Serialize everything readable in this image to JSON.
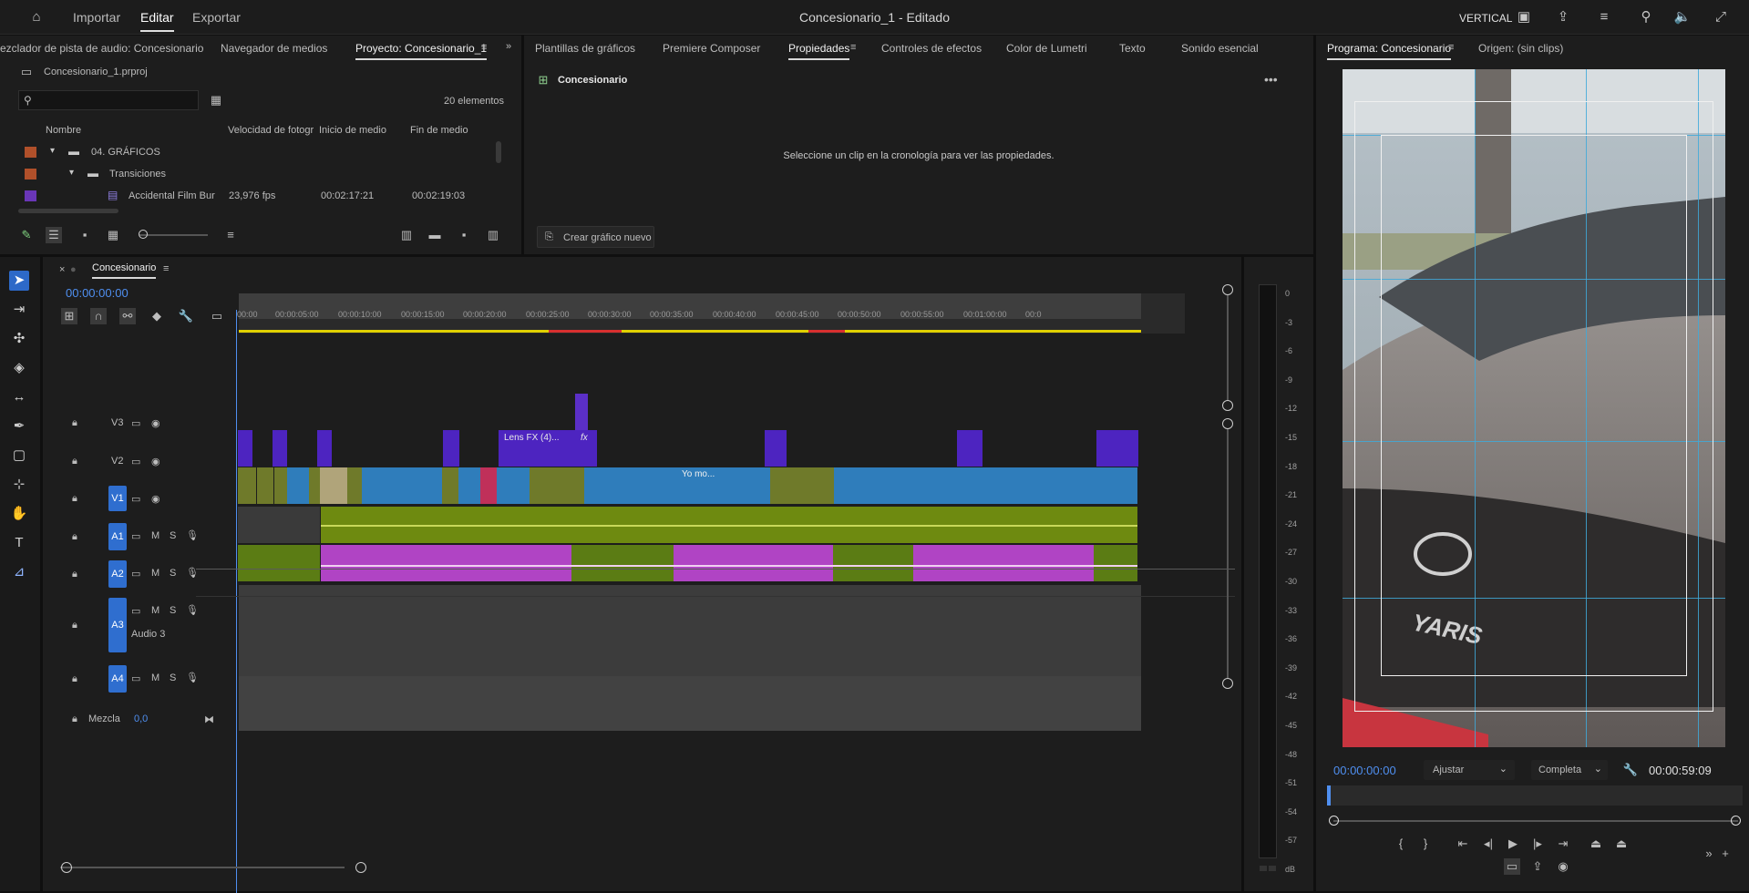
{
  "topbar": {
    "nav": [
      "Importar",
      "Editar",
      "Exportar"
    ],
    "title": "Concesionario_1 - Editado",
    "workspace": "VERTICAL"
  },
  "project_panel": {
    "tabs": [
      "ezclador de pista de audio: Concesionario",
      "Navegador de medios",
      "Proyecto: Concesionario_1"
    ],
    "file": "Concesionario_1.prproj",
    "search_placeholder": "",
    "count": "20 elementos",
    "columns": [
      "Nombre",
      "Velocidad de fotogr",
      "Inicio de medio",
      "Fin de medio"
    ],
    "rows": [
      {
        "name": "04. GRÁFICOS",
        "fps": "",
        "start": "",
        "end": "",
        "color": "#b0502a"
      },
      {
        "name": "Transiciones",
        "fps": "",
        "start": "",
        "end": "",
        "color": "#b0502a"
      },
      {
        "name": "Accidental Film Bur",
        "fps": "23,976 fps",
        "start": "00:02:17:21",
        "end": "00:02:19:03",
        "color": "#6a36b8"
      }
    ]
  },
  "props_panel": {
    "tabs": [
      "Plantillas de gráficos",
      "Premiere Composer",
      "Propiedades",
      "Controles de efectos",
      "Color de Lumetri",
      "Texto",
      "Sonido esencial"
    ],
    "sequence": "Concesionario",
    "message": "Seleccione un clip en la cronología para ver las propiedades.",
    "new_graphic": "Crear gráfico nuevo"
  },
  "program_panel": {
    "tabs": [
      "Programa: Concesionario",
      "Origen: (sin clips)"
    ],
    "timecode_left": "00:00:00:00",
    "fit": "Ajustar",
    "quality": "Completa",
    "timecode_right": "00:00:59:09",
    "car_text": "YARIS"
  },
  "timeline": {
    "sequence_tab": "Concesionario",
    "timecode": "00:00:00:00",
    "ruler": [
      "00:00",
      "00:00:05:00",
      "00:00:10:00",
      "00:00:15:00",
      "00:00:20:00",
      "00:00:25:00",
      "00:00:30:00",
      "00:00:35:00",
      "00:00:40:00",
      "00:00:45:00",
      "00:00:50:00",
      "00:00:55:00",
      "00:01:00:00",
      "00:0"
    ],
    "tracks": {
      "v3": "V3",
      "v2": "V2",
      "v1": "V1",
      "a1": "A1",
      "a2": "A2",
      "a3": "A3",
      "a4": "A4",
      "m": "M",
      "s": "S",
      "audio3_name": "Audio 3",
      "mix": "Mezcla",
      "mix_value": "0,0"
    },
    "clip_labels": [
      "Lens FX (4)...",
      "Yo mo...",
      "fx"
    ]
  },
  "meter": {
    "labels": [
      "0",
      "-3",
      "-6",
      "-9",
      "-12",
      "-15",
      "-18",
      "-21",
      "-24",
      "-27",
      "-30",
      "-33",
      "-36",
      "-39",
      "-42",
      "-45",
      "-48",
      "-51",
      "-54",
      "-57",
      "dB"
    ]
  }
}
